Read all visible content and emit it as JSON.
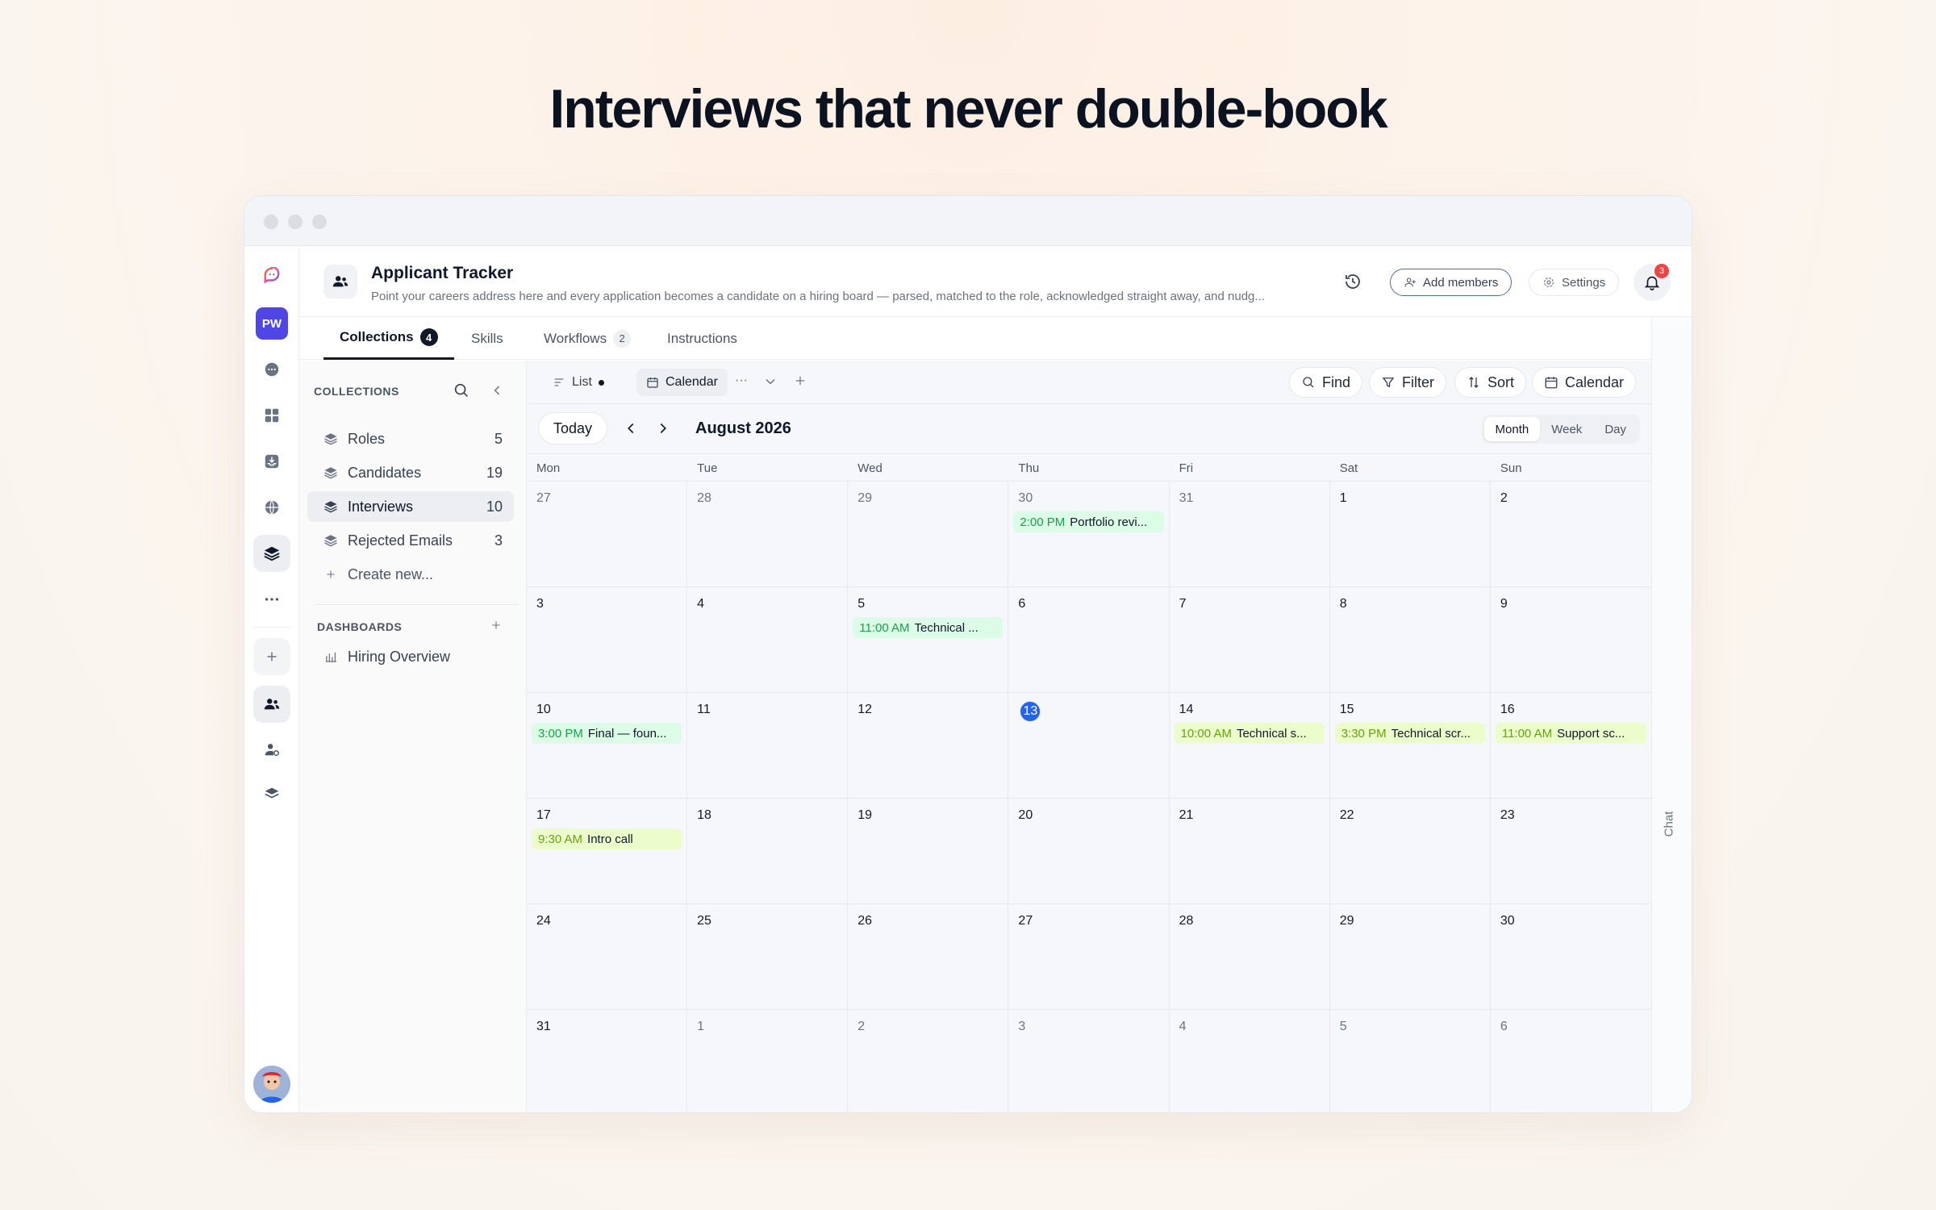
{
  "hero_title": "Interviews that never double-book",
  "rail": {
    "workspace_initials": "PW"
  },
  "header": {
    "title": "Applicant Tracker",
    "description": "Point your careers address here and every application becomes a candidate on a hiring board — parsed, matched to the role, acknowledged straight away, and nudg...",
    "add_members": "Add members",
    "settings": "Settings",
    "notification_count": "3"
  },
  "tabs": [
    {
      "label": "Collections",
      "badge": "4"
    },
    {
      "label": "Skills",
      "badge": ""
    },
    {
      "label": "Workflows",
      "badge": "2"
    },
    {
      "label": "Instructions",
      "badge": ""
    }
  ],
  "chat_label": "Chat",
  "panel": {
    "collections_heading": "COLLECTIONS",
    "items": [
      {
        "label": "Roles",
        "count": "5"
      },
      {
        "label": "Candidates",
        "count": "19"
      },
      {
        "label": "Interviews",
        "count": "10"
      },
      {
        "label": "Rejected Emails",
        "count": "3"
      }
    ],
    "create_new": "Create new...",
    "dashboards_heading": "DASHBOARDS",
    "dashboards": [
      {
        "label": "Hiring Overview"
      }
    ]
  },
  "views": {
    "list": "List",
    "calendar": "Calendar",
    "more": "···"
  },
  "toolbar": {
    "find": "Find",
    "filter": "Filter",
    "sort": "Sort",
    "calendar": "Calendar"
  },
  "calendar": {
    "today_label": "Today",
    "month_label": "August 2026",
    "modes": [
      "Month",
      "Week",
      "Day"
    ],
    "active_mode": "Month",
    "weekdays": [
      "Mon",
      "Tue",
      "Wed",
      "Thu",
      "Fri",
      "Sat",
      "Sun"
    ],
    "days": [
      {
        "d": "27",
        "out": true
      },
      {
        "d": "28",
        "out": true
      },
      {
        "d": "29",
        "out": true
      },
      {
        "d": "30",
        "out": true,
        "events": [
          {
            "time": "2:00 PM",
            "title": "Portfolio revi...",
            "color": "green"
          }
        ]
      },
      {
        "d": "31",
        "out": true
      },
      {
        "d": "1"
      },
      {
        "d": "2"
      },
      {
        "d": "3"
      },
      {
        "d": "4"
      },
      {
        "d": "5",
        "events": [
          {
            "time": "11:00 AM",
            "title": "Technical ...",
            "color": "green"
          }
        ]
      },
      {
        "d": "6"
      },
      {
        "d": "7"
      },
      {
        "d": "8"
      },
      {
        "d": "9"
      },
      {
        "d": "10",
        "events": [
          {
            "time": "3:00 PM",
            "title": "Final — foun...",
            "color": "green"
          }
        ]
      },
      {
        "d": "11"
      },
      {
        "d": "12"
      },
      {
        "d": "13",
        "today": true
      },
      {
        "d": "14",
        "events": [
          {
            "time": "10:00 AM",
            "title": "Technical s...",
            "color": "lime"
          }
        ]
      },
      {
        "d": "15",
        "events": [
          {
            "time": "3:30 PM",
            "title": "Technical scr...",
            "color": "lime"
          }
        ]
      },
      {
        "d": "16",
        "events": [
          {
            "time": "11:00 AM",
            "title": "Support sc...",
            "color": "lime"
          }
        ]
      },
      {
        "d": "17",
        "events": [
          {
            "time": "9:30 AM",
            "title": "Intro call",
            "color": "lime"
          }
        ]
      },
      {
        "d": "18"
      },
      {
        "d": "19"
      },
      {
        "d": "20"
      },
      {
        "d": "21"
      },
      {
        "d": "22"
      },
      {
        "d": "23"
      },
      {
        "d": "24"
      },
      {
        "d": "25"
      },
      {
        "d": "26"
      },
      {
        "d": "27"
      },
      {
        "d": "28"
      },
      {
        "d": "29"
      },
      {
        "d": "30"
      },
      {
        "d": "31"
      },
      {
        "d": "1",
        "out": true
      },
      {
        "d": "2",
        "out": true
      },
      {
        "d": "3",
        "out": true
      },
      {
        "d": "4",
        "out": true
      },
      {
        "d": "5",
        "out": true
      },
      {
        "d": "6",
        "out": true
      }
    ]
  },
  "colors": {
    "accent": "#2563eb",
    "event_green_bg": "#dcfce7",
    "event_green_time": "#16a34a",
    "event_lime_bg": "#ecfccb",
    "event_lime_time": "#65a30d",
    "workspace": "#4f46e5"
  }
}
